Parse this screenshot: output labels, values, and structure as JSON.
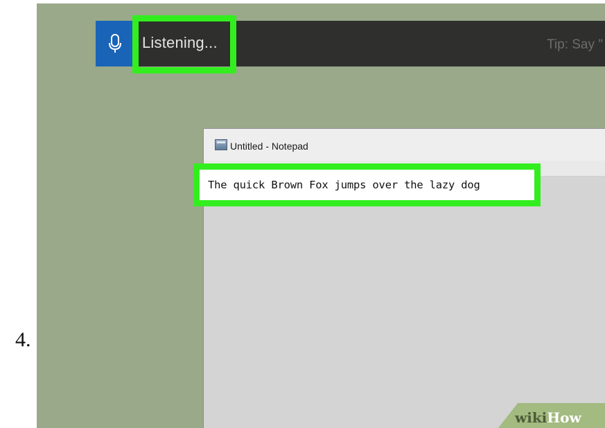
{
  "step": {
    "number": "4."
  },
  "dictation": {
    "mic_icon": "microphone-icon",
    "status_text": "Listening...",
    "tip_text": "Tip: Say \""
  },
  "notepad": {
    "icon": "notepad-icon",
    "title": "Untitled - Notepad",
    "content": "The quick Brown Fox jumps over the lazy dog"
  },
  "watermark": {
    "part1": "wiki",
    "part2": "How"
  },
  "colors": {
    "highlight": "#33ee1f",
    "background": "#9aa98a",
    "dictation_bar": "#2f302d",
    "mic_button": "#1a64b8"
  }
}
